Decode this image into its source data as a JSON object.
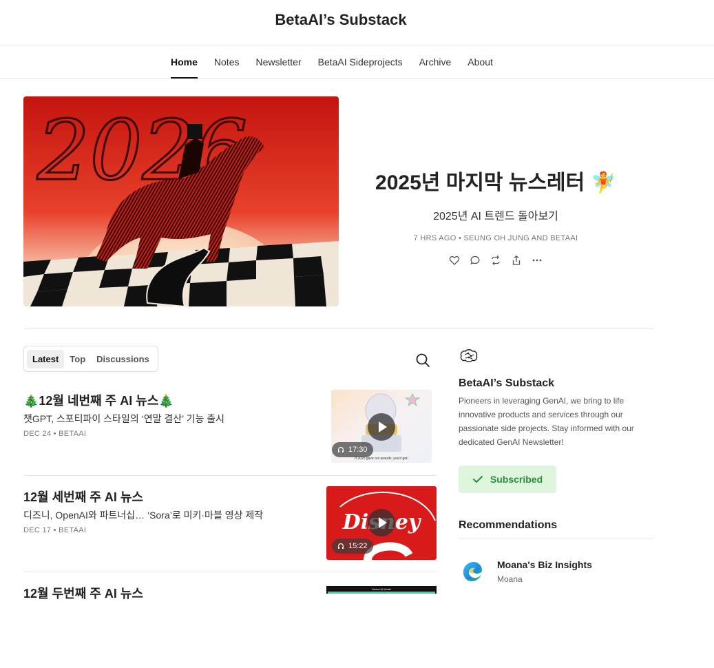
{
  "site": {
    "title": "BetaAI’s Substack"
  },
  "nav": {
    "items": [
      {
        "label": "Home",
        "active": true
      },
      {
        "label": "Notes"
      },
      {
        "label": "Newsletter"
      },
      {
        "label": "BetaAI Sideprojects"
      },
      {
        "label": "Archive"
      },
      {
        "label": "About"
      }
    ]
  },
  "hero": {
    "title": "2025년 마지막 뉴스레터 🧚",
    "subtitle": "2025년 AI 트렌드 돌아보기",
    "meta": "7 HRS AGO • SEUNG OH JUNG AND BETAAI",
    "image_text": "2026",
    "icons": [
      "heart-icon",
      "comment-icon",
      "restack-icon",
      "share-icon",
      "more-icon"
    ]
  },
  "feed": {
    "tabs": [
      {
        "label": "Latest",
        "active": true
      },
      {
        "label": "Top"
      },
      {
        "label": "Discussions"
      }
    ],
    "posts": [
      {
        "title": "🎄12월 네번째 주 AI 뉴스🎄",
        "subtitle": "챗GPT, 스포티파이 스타일의 ‘연말 결산’ 기능 출시",
        "meta": "DEC 24 • BETAAI",
        "duration": "17:30",
        "thumb_caption": "If 2025 gave out awards, you'd get:"
      },
      {
        "title": "12월 세번째 주 AI 뉴스",
        "subtitle": "디즈니, OpenAI와 파트너십… ‘Sora’로 미키·마블 영상 제작",
        "meta": "DEC 17 • BETAAI",
        "duration": "15:22",
        "thumb_text": "Disney"
      },
      {
        "title": "12월 두번째 주 AI 뉴스",
        "thumb_caption": "Global AI Model"
      }
    ]
  },
  "sidebar": {
    "name": "BetaAI’s Substack",
    "description": "Pioneers in leveraging GenAI, we bring to life innovative products and services through our passionate side projects. Stay informed with our dedicated GenAI Newsletter!",
    "subscribe_label": "Subscribed",
    "recommendations_title": "Recommendations",
    "recommendations": [
      {
        "name": "Moana's Biz Insights",
        "author": "Moana"
      }
    ]
  },
  "colors": {
    "accent_green": "#2e8b3e",
    "subscribed_bg": "#dcf5dc"
  }
}
